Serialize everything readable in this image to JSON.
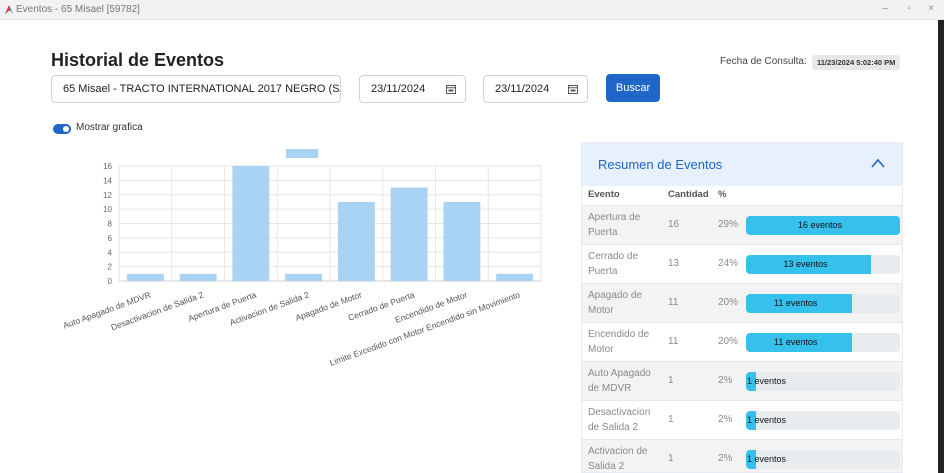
{
  "window": {
    "title": "Eventos - 65 Misael [59782]"
  },
  "header": {
    "title": "Historial de Eventos",
    "consult_label": "Fecha de Consulta:",
    "consult_value": "11/23/2024 5:02:40 PM"
  },
  "filters": {
    "vehicle": "65 Misael - TRACTO INTERNATIONAL 2017 NEGRO (S/P)",
    "date_from": "23/11/2024",
    "date_to": "23/11/2024",
    "search_label": "Buscar"
  },
  "toggle": {
    "label": "Mostrar grafica",
    "on": true
  },
  "colors": {
    "accent": "#1f66c8",
    "bar": "#a9d3f5",
    "progress": "#36c0ec",
    "header_bg": "#e7f0fd"
  },
  "icons": {
    "calendar": "calendar-icon",
    "collapse": "chevron-up-icon"
  },
  "chart_data": {
    "type": "bar",
    "categories": [
      "Auto Apagado de MDVR",
      "Desactivacion de Salida 2",
      "Apertura de Puerta",
      "Activacion de Salida 2",
      "Apagado de Motor",
      "Cerrado de Puerta",
      "Encendido de Motor",
      "Limite Excedido con Motor Encendido sin Movimiento"
    ],
    "values": [
      1,
      1,
      16,
      1,
      11,
      13,
      11,
      1
    ],
    "yticks": [
      0,
      2,
      4,
      6,
      8,
      10,
      12,
      14,
      16
    ],
    "ylim": [
      0,
      16
    ],
    "grid": true,
    "legend": "top",
    "color": "#a9d3f5"
  },
  "summary": {
    "title": "Resumen de Eventos",
    "columns": [
      "Evento",
      "Cantidad",
      "%"
    ],
    "rows": [
      {
        "event": "Apertura de Puerta",
        "count": "16",
        "pct": "29%",
        "bar_label": "16 eventos",
        "fill": 1.0
      },
      {
        "event": "Cerrado de Puerta",
        "count": "13",
        "pct": "24%",
        "bar_label": "13 eventos",
        "fill": 0.8125
      },
      {
        "event": "Apagado de Motor",
        "count": "11",
        "pct": "20%",
        "bar_label": "11 eventos",
        "fill": 0.6875
      },
      {
        "event": "Encendido de Motor",
        "count": "11",
        "pct": "20%",
        "bar_label": "11 eventos",
        "fill": 0.6875
      },
      {
        "event": "Auto Apagado de MDVR",
        "count": "1",
        "pct": "2%",
        "bar_label": "1 eventos",
        "fill": 0.0625
      },
      {
        "event": "Desactivacion de Salida 2",
        "count": "1",
        "pct": "2%",
        "bar_label": "1 eventos",
        "fill": 0.0625
      },
      {
        "event": "Activacion de Salida 2",
        "count": "1",
        "pct": "2%",
        "bar_label": "1 eventos",
        "fill": 0.0625
      }
    ]
  }
}
